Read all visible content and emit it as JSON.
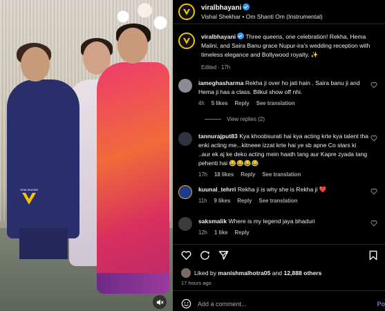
{
  "post": {
    "username": "viralbhayani",
    "audio": "Vishal Shekhar • Om Shanti Om (Instrumental)",
    "caption": "Three queens, one celebration! Rekha, Hema Malini, and Saira Banu grace Nupur-ira's wedding reception with timeless elegance and Bollywood royalty. ✨",
    "caption_meta": "Edited · 17h",
    "liked_by_prefix": "Liked by ",
    "liked_by_user": "manishmalhotra05",
    "liked_by_and": " and ",
    "liked_by_count": "12,888 others",
    "posted_time": "17 hours ago",
    "add_comment_placeholder": "Add a comment...",
    "post_label": "Po",
    "watermark_text": "VIRAL BHAYANI"
  },
  "comments": [
    {
      "username": "iameghasharma",
      "text": "Rekha ji over ho jati hain . Saira banu ji and Hema ji has a class. Bilkul show off nhi.",
      "time": "4h",
      "likes": "5 likes",
      "reply": "Reply",
      "translate": "See translation"
    },
    {
      "username": "tannurajput83",
      "text": "Kya khoobsurati hai kya acting krte kya talent tha enki acting me...kitneee izzat krte hai ye sb apne Co stars ki ..aur ek aj ke deko acting mein haath tang aur Kapre zyada tang pehenti hai 😂😂😂😂",
      "time": "17h",
      "likes": "18 likes",
      "reply": "Reply",
      "translate": "See translation"
    },
    {
      "username": "kuunal_tehrri",
      "text": "Rekha ji is why she is Rekha ji ❤️",
      "time": "11h",
      "likes": "9 likes",
      "reply": "Reply",
      "translate": "See translation"
    },
    {
      "username": "saksmalik",
      "text": "Where is my legend jaya bhaduri",
      "time": "12h",
      "likes": "1 like",
      "reply": "Reply",
      "translate": ""
    }
  ],
  "view_replies": "View replies (2)",
  "icons": {
    "like": "heart-icon",
    "comment": "comment-icon",
    "share": "share-icon",
    "save": "bookmark-icon",
    "mute": "speaker-muted-icon",
    "emoji": "smiley-icon"
  },
  "colors": {
    "background": "#000000",
    "verified": "#3897f0",
    "post_link": "#6b7fb3",
    "brand_ring": "#f5c400"
  }
}
